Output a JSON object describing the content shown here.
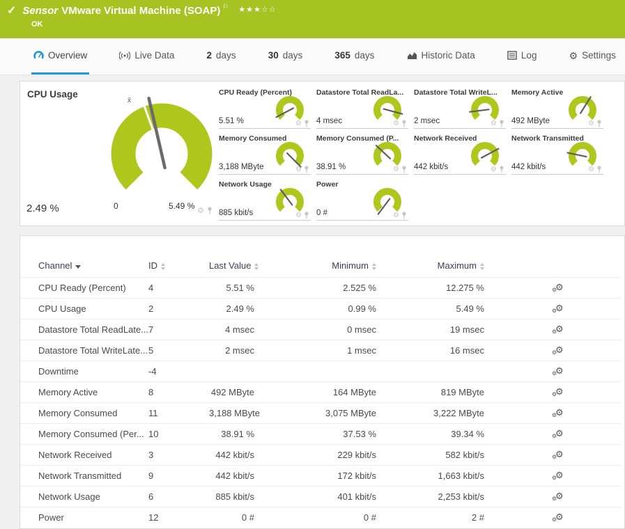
{
  "header": {
    "kind_label": "Sensor",
    "title": "VMware Virtual Machine (SOAP)",
    "status": "OK",
    "stars_filled": 3,
    "stars_total": 5
  },
  "tabs": [
    {
      "id": "overview",
      "icon": "gauge-icon",
      "label": "Overview",
      "active": true
    },
    {
      "id": "live-data",
      "icon": "live-icon",
      "label": "Live Data"
    },
    {
      "id": "2-days",
      "num": "2",
      "label": "days"
    },
    {
      "id": "30-days",
      "num": "30",
      "label": "days"
    },
    {
      "id": "365-days",
      "num": "365",
      "label": "days"
    },
    {
      "id": "historic-data",
      "icon": "chart-icon",
      "label": "Historic Data"
    },
    {
      "id": "log",
      "icon": "log-icon",
      "label": "Log"
    },
    {
      "id": "settings",
      "icon": "gear-icon",
      "label": "Settings"
    }
  ],
  "big_gauge": {
    "title": "CPU Usage",
    "current": "2.49 %",
    "min": "0",
    "max": "5.49 %",
    "avg_marker": "x̄",
    "needle_angle": -13
  },
  "mini_gauges": [
    {
      "title": "CPU Ready (Percent)",
      "value": "5.51 %",
      "needle_angle": -118
    },
    {
      "title": "Datastore Total ReadLa...",
      "value": "4 msec",
      "needle_angle": 105
    },
    {
      "title": "Datastore Total WriteL...",
      "value": "2 msec",
      "needle_angle": -97
    },
    {
      "title": "Memory Active",
      "value": "492 MByte",
      "needle_angle": 32
    },
    {
      "title": "Memory Consumed",
      "value": "3,188 MByte",
      "needle_angle": 135
    },
    {
      "title": "Memory Consumed (P...",
      "value": "38.91 %",
      "needle_angle": -47
    },
    {
      "title": "Network Received",
      "value": "442 kbit/s",
      "needle_angle": 62
    },
    {
      "title": "Network Transmitted",
      "value": "442 kbit/s",
      "needle_angle": -78
    },
    {
      "title": "Network Usage",
      "value": "885 kbit/s",
      "needle_angle": -37
    },
    {
      "title": "Power",
      "value": "0 #",
      "needle_angle": -143
    }
  ],
  "table": {
    "columns": [
      {
        "label": "Channel",
        "sort": "desc"
      },
      {
        "label": "ID",
        "sort": "both"
      },
      {
        "label": "Last Value",
        "sort": "both"
      },
      {
        "label": "Minimum",
        "sort": "both"
      },
      {
        "label": "Maximum",
        "sort": "both"
      }
    ],
    "rows": [
      {
        "channel": "CPU Ready (Percent)",
        "id": "4",
        "last": "5.51 %",
        "min": "2.525 %",
        "max": "12.275 %"
      },
      {
        "channel": "CPU Usage",
        "id": "2",
        "last": "2.49 %",
        "min": "0.99 %",
        "max": "5.49 %"
      },
      {
        "channel": "Datastore Total ReadLate...",
        "id": "7",
        "last": "4 msec",
        "min": "0 msec",
        "max": "19 msec"
      },
      {
        "channel": "Datastore Total WriteLate...",
        "id": "5",
        "last": "2 msec",
        "min": "1 msec",
        "max": "16 msec"
      },
      {
        "channel": "Downtime",
        "id": "-4",
        "last": "",
        "min": "",
        "max": ""
      },
      {
        "channel": "Memory Active",
        "id": "8",
        "last": "492 MByte",
        "min": "164 MByte",
        "max": "819 MByte"
      },
      {
        "channel": "Memory Consumed",
        "id": "11",
        "last": "3,188 MByte",
        "min": "3,075 MByte",
        "max": "3,222 MByte"
      },
      {
        "channel": "Memory Consumed (Per...",
        "id": "10",
        "last": "38.91 %",
        "min": "37.53 %",
        "max": "39.34 %"
      },
      {
        "channel": "Network Received",
        "id": "3",
        "last": "442 kbit/s",
        "min": "229 kbit/s",
        "max": "582 kbit/s"
      },
      {
        "channel": "Network Transmitted",
        "id": "9",
        "last": "442 kbit/s",
        "min": "172 kbit/s",
        "max": "1,663 kbit/s"
      },
      {
        "channel": "Network Usage",
        "id": "6",
        "last": "885 kbit/s",
        "min": "401 kbit/s",
        "max": "2,253 kbit/s"
      },
      {
        "channel": "Power",
        "id": "12",
        "last": "0 #",
        "min": "0 #",
        "max": "2 #"
      }
    ]
  },
  "colors": {
    "status_green": "#a7c322",
    "gauge_green": "#adc71c",
    "accent_blue": "#2197d3",
    "needle_gray": "#6b6b6b"
  }
}
